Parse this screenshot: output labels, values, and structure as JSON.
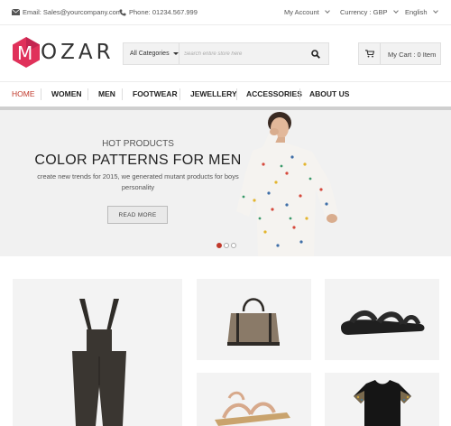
{
  "topbar": {
    "email": "Email: Sales@yourcompany.com",
    "phone": "Phone: 01234.567.999",
    "account": "My Account",
    "currency": "Currency : GBP",
    "language": "English"
  },
  "header": {
    "logo_text": "OZAR",
    "logo_mark": "M",
    "search_category": "All Categories",
    "search_placeholder": "Search entire store here",
    "cart_label": "My Cart : 0 Item"
  },
  "nav": {
    "items": [
      "HOME",
      "WOMEN",
      "MEN",
      "FOOTWEAR",
      "JEWELLERY",
      "ACCESSORIES",
      "ABOUT US"
    ]
  },
  "hero": {
    "subtitle": "HOT PRODUCTS",
    "title": "COLOR PATTERNS FOR MEN",
    "description": "create new trends for 2015, we generated mutant products for boys personality",
    "button": "READ MORE",
    "slides": 3,
    "active_slide": 1
  },
  "products": [
    {
      "icon": "overalls-image"
    },
    {
      "icon": "handbag-image"
    },
    {
      "icon": "sandal-image"
    },
    {
      "icon": "heels-image"
    },
    {
      "icon": "tshirt-image"
    }
  ],
  "colors": {
    "accent": "#c0392b",
    "logo": "#e0315a"
  }
}
